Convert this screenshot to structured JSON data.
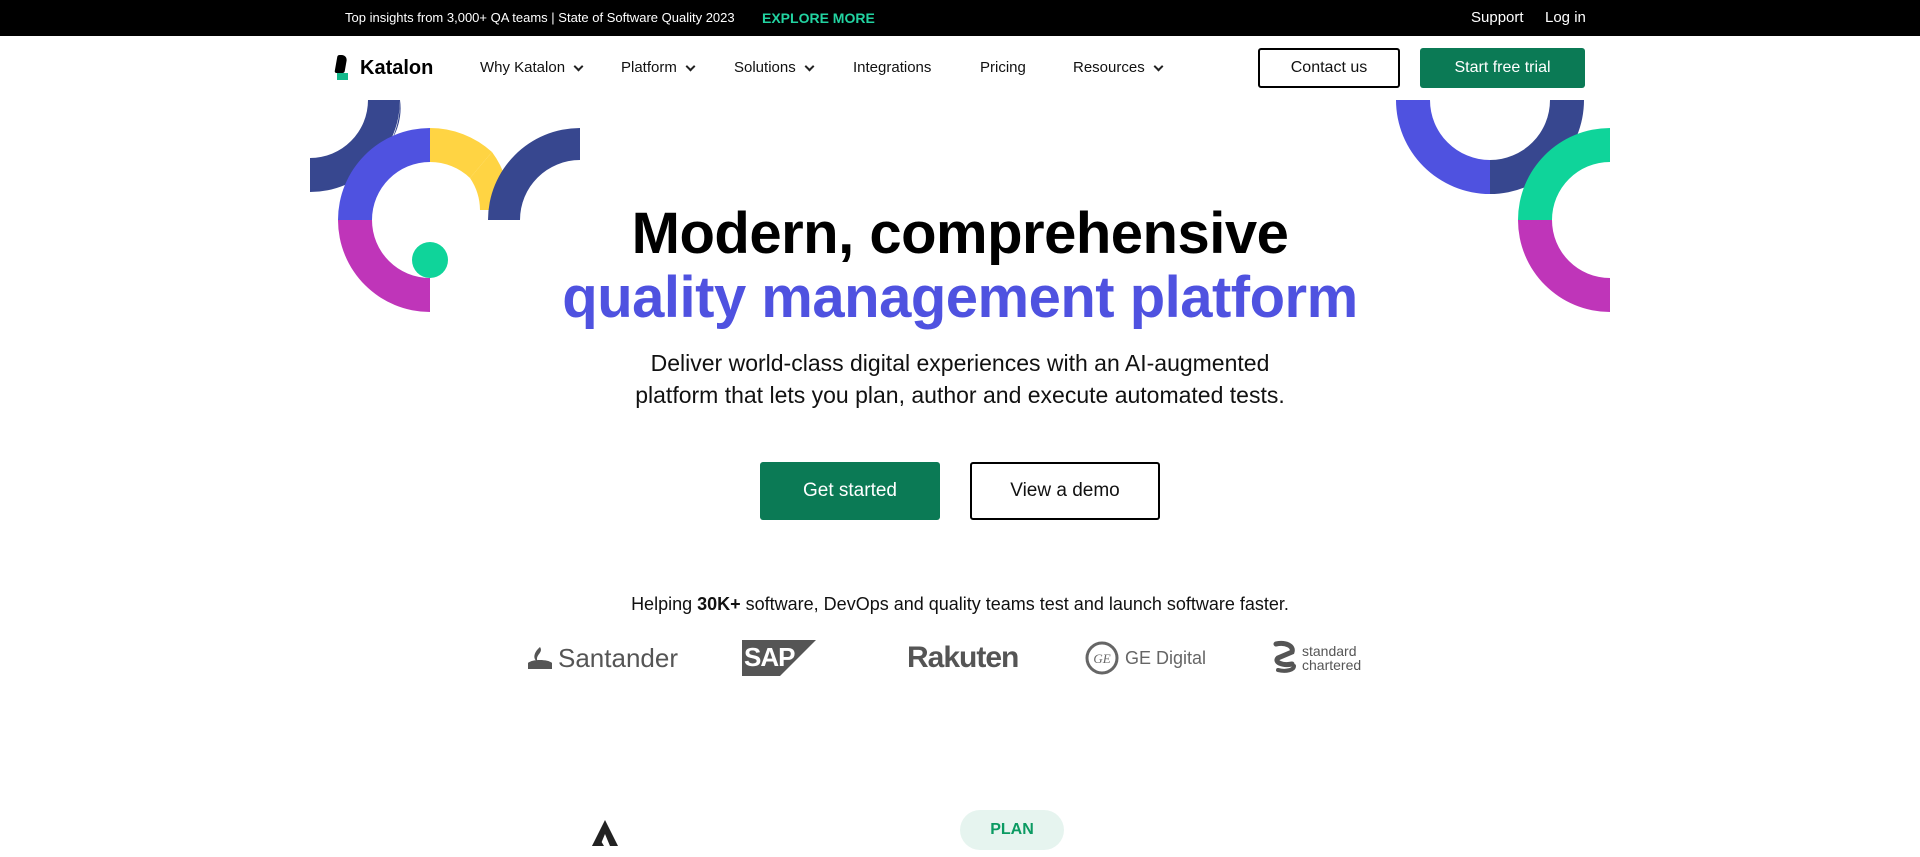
{
  "topbar": {
    "promo": "Top insights from 3,000+ QA teams | State of Software Quality 2023",
    "explore": "EXPLORE MORE",
    "support": "Support",
    "login": "Log in"
  },
  "nav": {
    "brand": "Katalon",
    "items": [
      {
        "label": "Why Katalon",
        "has_menu": true
      },
      {
        "label": "Platform",
        "has_menu": true
      },
      {
        "label": "Solutions",
        "has_menu": true
      },
      {
        "label": "Integrations",
        "has_menu": false
      },
      {
        "label": "Pricing",
        "has_menu": false
      },
      {
        "label": "Resources",
        "has_menu": true
      }
    ],
    "contact": "Contact us",
    "trial": "Start free trial"
  },
  "hero": {
    "title_line1": "Modern, comprehensive",
    "title_line2": "quality management platform",
    "subtitle_line1": "Deliver world-class digital experiences with an AI-augmented",
    "subtitle_line2": "platform that lets you plan, author and execute automated tests.",
    "cta_primary": "Get started",
    "cta_secondary": "View a demo"
  },
  "social_proof": {
    "prefix": "Helping ",
    "highlight": "30K+",
    "suffix": " software, DevOps and quality teams test and launch software faster.",
    "logos": [
      "Santander",
      "SAP",
      "Rakuten",
      "GE Digital",
      "standard chartered"
    ]
  },
  "section": {
    "pill": "PLAN"
  },
  "colors": {
    "brand_green": "#0b7a55",
    "accent_blue": "#4f52e0",
    "explore_green": "#22d3a1",
    "deco_navy": "#37478f",
    "deco_yellow": "#ffd443",
    "deco_magenta": "#bf35b9",
    "deco_teal": "#0fd49a"
  }
}
